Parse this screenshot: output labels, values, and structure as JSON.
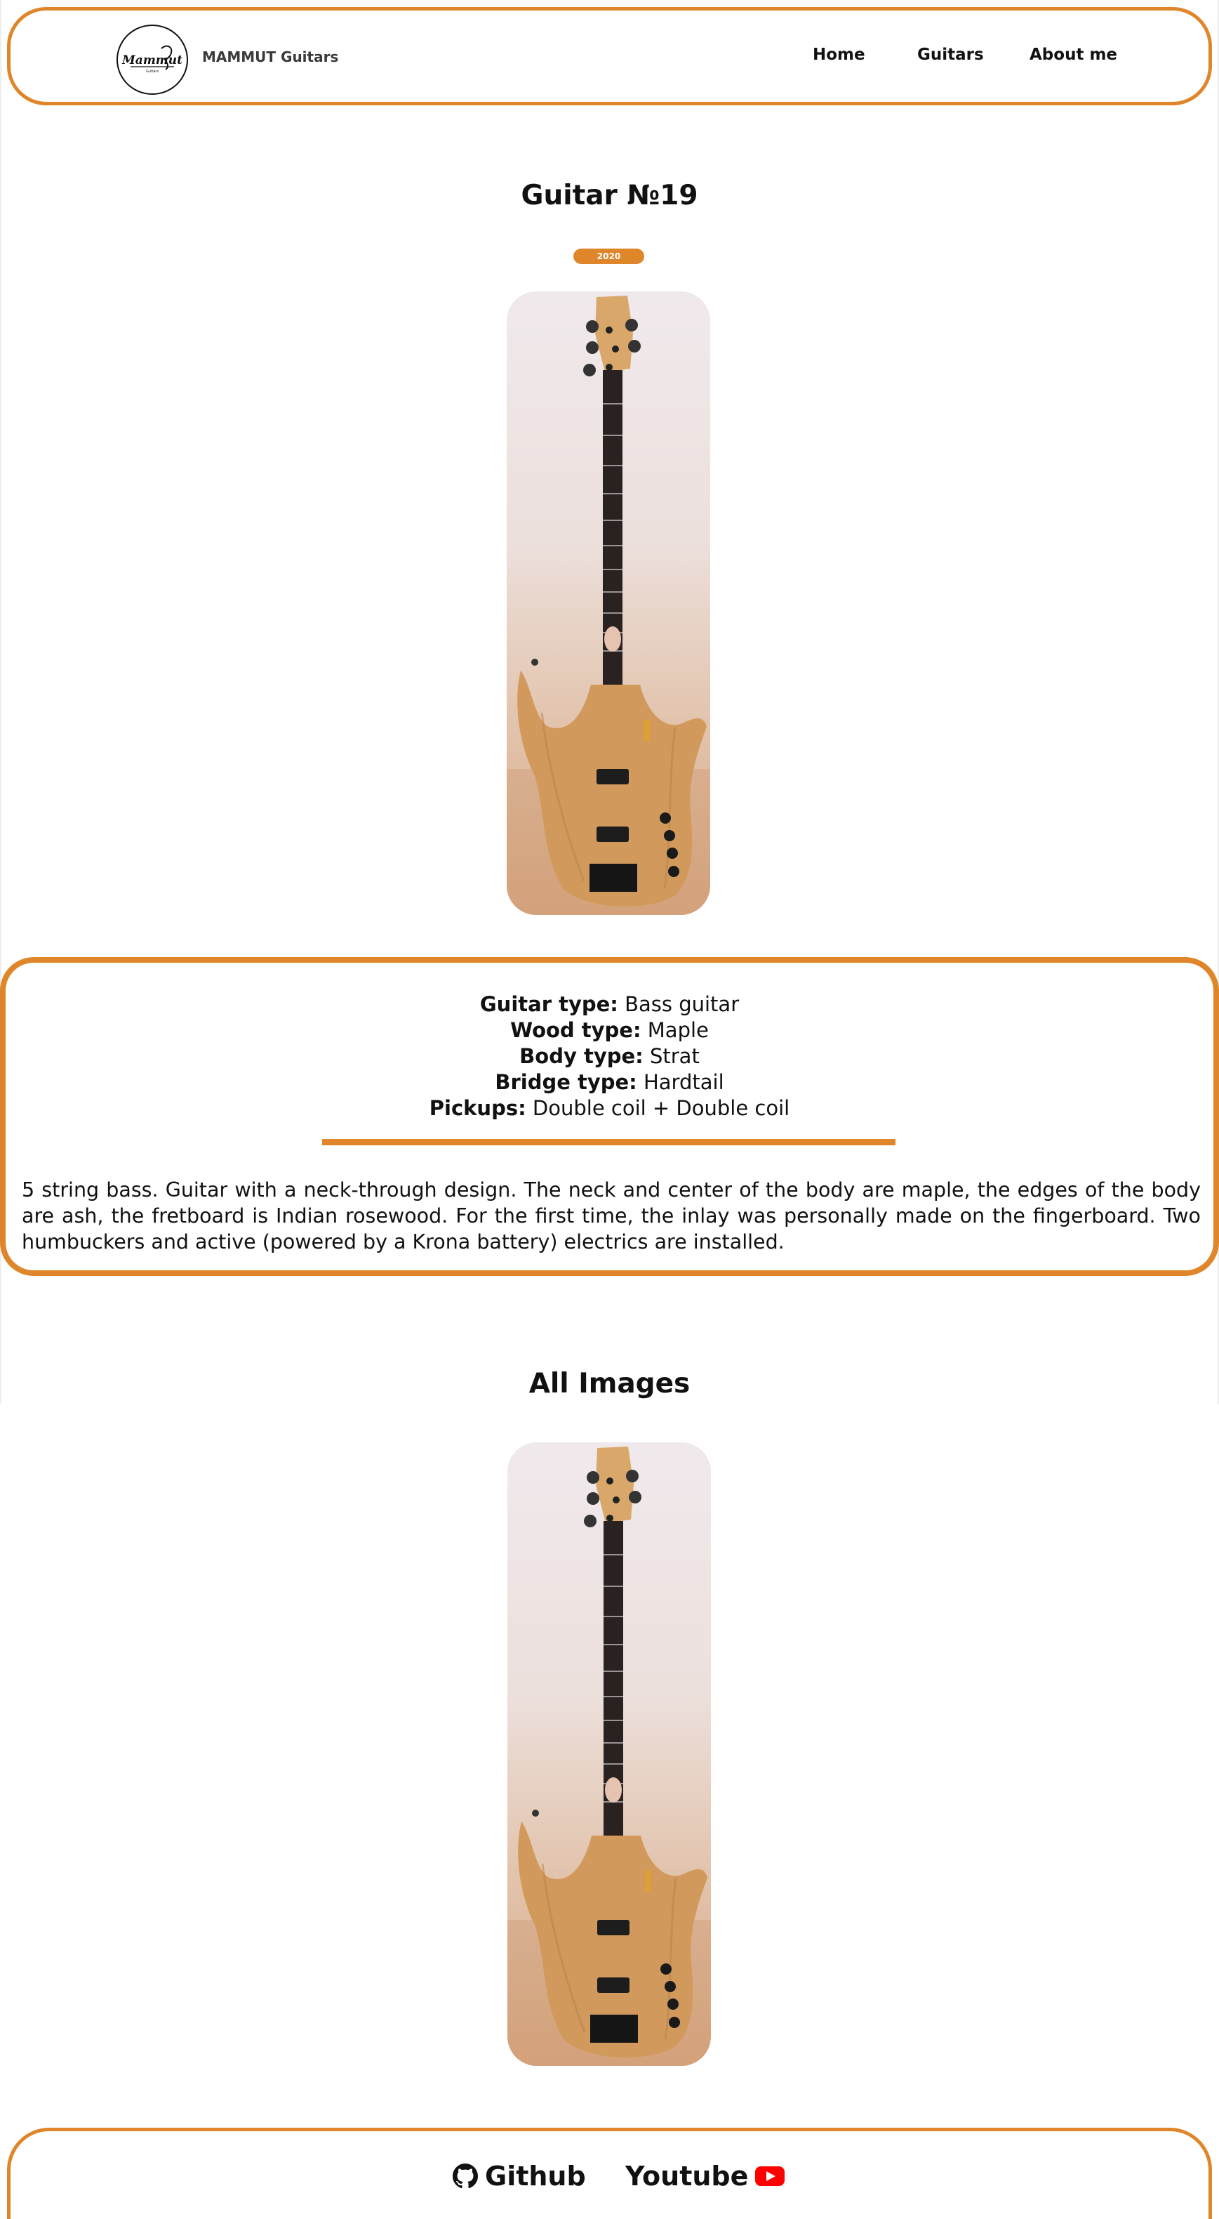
{
  "header": {
    "brand": "MAMMUT Guitars",
    "logo_text": "Mammut",
    "nav": [
      "Home",
      "Guitars",
      "About me"
    ]
  },
  "guitar": {
    "title": "Guitar №19",
    "year": "2020",
    "specs": [
      {
        "label": "Guitar type:",
        "value": "Bass guitar"
      },
      {
        "label": "Wood type:",
        "value": "Maple"
      },
      {
        "label": "Body type:",
        "value": "Strat"
      },
      {
        "label": "Bridge type:",
        "value": "Hardtail"
      },
      {
        "label": "Pickups:",
        "value": "Double coil + Double coil"
      }
    ],
    "description": "5 string bass. Guitar with a neck-through design. The neck and center of the body are maple, the edges of the body are ash, the fretboard is Indian rosewood. For the first time, the inlay was personally made on the fingerboard. Two humbuckers and active (powered by a Krona battery) electrics are installed."
  },
  "gallery": {
    "title": "All Images"
  },
  "footer": {
    "github": "Github",
    "youtube": "Youtube"
  },
  "colors": {
    "accent": "#e0862a",
    "youtube_red": "#ff0000"
  }
}
